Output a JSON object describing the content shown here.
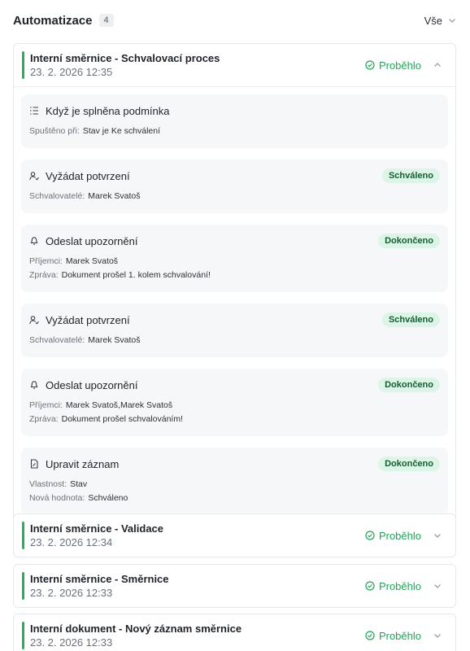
{
  "header": {
    "title": "Automatizace",
    "count": "4",
    "filter_label": "Vše"
  },
  "colors": {
    "accent_green": "#21b35a",
    "badge_bg": "#dcf5e6"
  },
  "automations": [
    {
      "title": "Interní směrnice - Schvalovací proces",
      "date": "23. 2. 2026 12:35",
      "status": "Proběhlo",
      "expanded": true,
      "steps": [
        {
          "icon": "condition-list-icon",
          "name": "Když je splněna podmínka",
          "badge": "",
          "fields": [
            {
              "key": "Spuštěno při:",
              "value": "Stav je Ke schválení"
            }
          ]
        },
        {
          "icon": "user-check-icon",
          "name": "Vyžádat potvrzení",
          "badge": "Schváleno",
          "fields": [
            {
              "key": "Schvalovatelé:",
              "value": "Marek Svatoš"
            }
          ]
        },
        {
          "icon": "bell-icon",
          "name": "Odeslat upozornění",
          "badge": "Dokončeno",
          "fields": [
            {
              "key": "Příjemci:",
              "value": "Marek Svatoš"
            },
            {
              "key": "Zpráva:",
              "value": "Dokument prošel 1. kolem schvalování!"
            }
          ]
        },
        {
          "icon": "user-check-icon",
          "name": "Vyžádat potvrzení",
          "badge": "Schváleno",
          "fields": [
            {
              "key": "Schvalovatelé:",
              "value": "Marek Svatoš"
            }
          ]
        },
        {
          "icon": "bell-icon",
          "name": "Odeslat upozornění",
          "badge": "Dokončeno",
          "fields": [
            {
              "key": "Příjemci:",
              "value": "Marek Svatoš,Marek Svatoš"
            },
            {
              "key": "Zpráva:",
              "value": "Dokument prošel schvalováním!"
            }
          ]
        },
        {
          "icon": "document-edit-icon",
          "name": "Upravit záznam",
          "badge": "Dokončeno",
          "fields": [
            {
              "key": "Vlastnost:",
              "value": "Stav"
            },
            {
              "key": "Nová hodnota:",
              "value": "Schváleno"
            }
          ]
        }
      ]
    },
    {
      "title": "Interní směrnice - Validace",
      "date": "23. 2. 2026 12:34",
      "status": "Proběhlo",
      "expanded": false
    },
    {
      "title": "Interní směrnice - Směrnice",
      "date": "23. 2. 2026 12:33",
      "status": "Proběhlo",
      "expanded": false
    },
    {
      "title": "Interní dokument - Nový záznam směrnice",
      "date": "23. 2. 2026 12:33",
      "status": "Proběhlo",
      "expanded": false
    }
  ]
}
